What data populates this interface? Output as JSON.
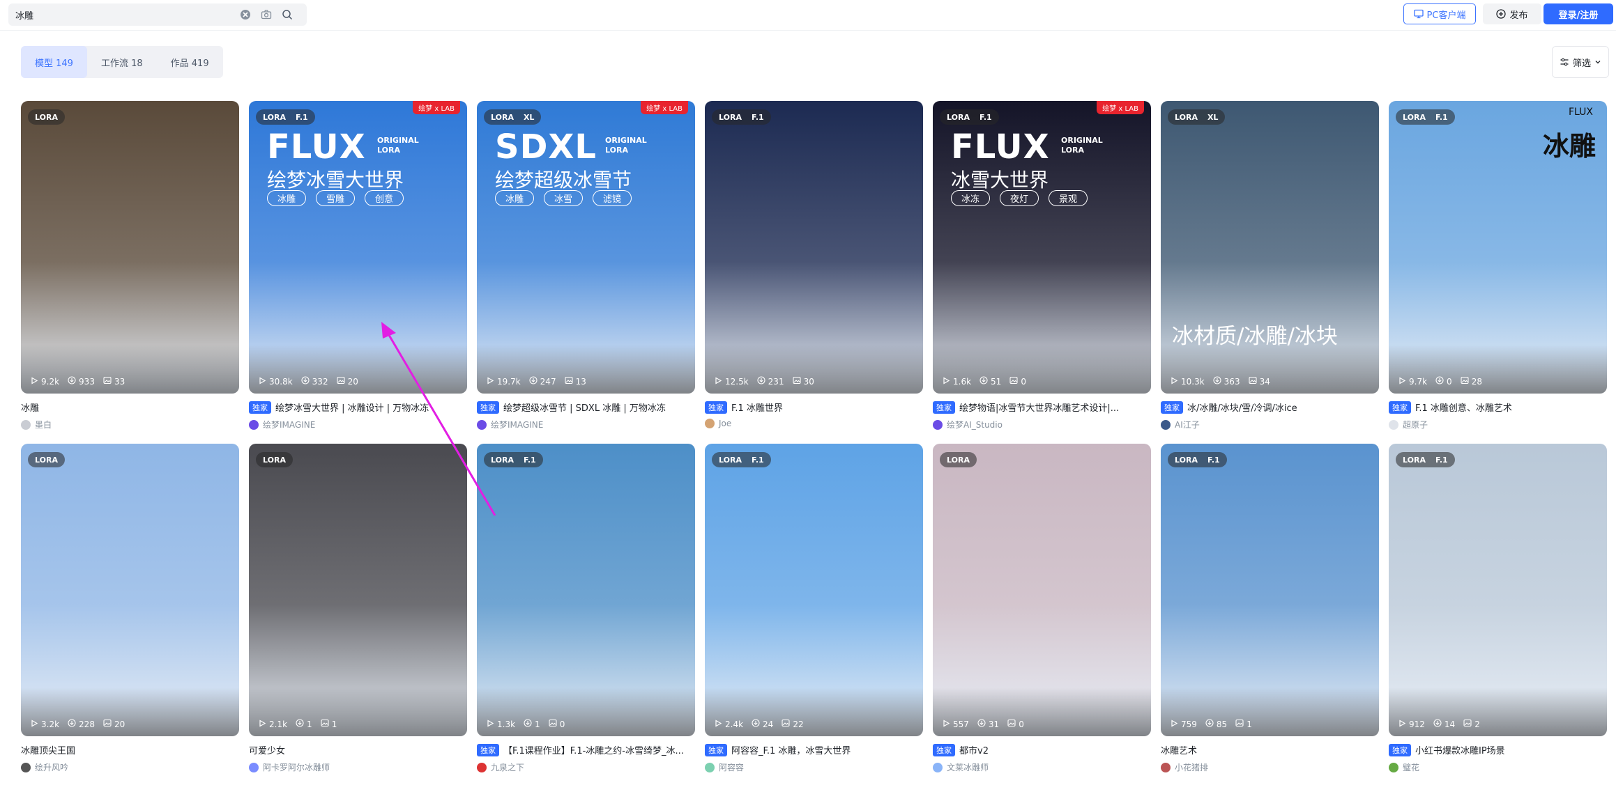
{
  "search": {
    "value": "冰雕"
  },
  "header": {
    "pc_client": "PC客户端",
    "publish": "发布",
    "login": "登录/注册"
  },
  "tabs": [
    {
      "label": "模型 149",
      "active": true
    },
    {
      "label": "工作流 18",
      "active": false
    },
    {
      "label": "作品 419",
      "active": false
    }
  ],
  "filter": {
    "label": "筛选"
  },
  "badge_exclusive": "独家",
  "cards": [
    {
      "tags": [
        "LORA"
      ],
      "runs": "9.2k",
      "downloads": "933",
      "images": "33",
      "title": "冰雕",
      "exclusive": false,
      "author": "墨白",
      "bg": "#5a4a3a"
    },
    {
      "tags": [
        "LORA",
        "F.1"
      ],
      "ribbon": "绘梦 x LAB",
      "poster": {
        "big": "FLUX",
        "small": "ORIGINAL LORA",
        "sub": "绘梦冰雪大世界",
        "chips": [
          "冰雕",
          "雪雕",
          "创意"
        ]
      },
      "runs": "30.8k",
      "downloads": "332",
      "images": "20",
      "title": "绘梦冰雪大世界 | 冰雕设计 | 万物冰冻",
      "exclusive": true,
      "author": "绘梦IMAGINE",
      "bg": "#2e78d8"
    },
    {
      "tags": [
        "LORA",
        "XL"
      ],
      "ribbon": "绘梦 x LAB",
      "poster": {
        "big": "SDXL",
        "small": "ORIGINAL LORA",
        "sub": "绘梦超级冰雪节",
        "chips": [
          "冰雕",
          "冰雪",
          "滤镜"
        ]
      },
      "runs": "19.7k",
      "downloads": "247",
      "images": "13",
      "title": "绘梦超级冰雪节 | SDXL 冰雕 | 万物冰冻",
      "exclusive": true,
      "author": "绘梦IMAGINE",
      "bg": "#2f7ad6"
    },
    {
      "tags": [
        "LORA",
        "F.1"
      ],
      "runs": "12.5k",
      "downloads": "231",
      "images": "30",
      "title": "F.1 冰雕世界",
      "exclusive": true,
      "author": "Joe",
      "bg": "#1c2a52"
    },
    {
      "tags": [
        "LORA",
        "F.1"
      ],
      "ribbon": "绘梦 x LAB",
      "poster": {
        "big": "FLUX",
        "small": "ORIGINAL LORA",
        "sub": "冰雪大世界",
        "chips": [
          "冰冻",
          "夜灯",
          "景观"
        ]
      },
      "runs": "1.6k",
      "downloads": "51",
      "images": "0",
      "title": "绘梦物语|冰雪节大世界冰雕艺术设计|...",
      "exclusive": true,
      "author": "绘梦AI_Studio",
      "bg": "#141428"
    },
    {
      "tags": [
        "LORA",
        "XL"
      ],
      "runs": "10.3k",
      "downloads": "363",
      "images": "34",
      "title": "冰/冰雕/冰块/雪/冷调/冰ice",
      "exclusive": true,
      "author": "AI江子",
      "poster_text": "冰材质/冰雕/冰块",
      "bg": "#3e5872"
    },
    {
      "tags": [
        "LORA",
        "F.1"
      ],
      "runs": "9.7k",
      "downloads": "0",
      "images": "28",
      "title": "F.1 冰雕创意、冰雕艺术",
      "exclusive": true,
      "author": "超原子",
      "corner_big": "冰雕",
      "corner_small": "FLUX",
      "bg": "#6aa6e0"
    },
    {
      "tags": [
        "LORA"
      ],
      "runs": "3.2k",
      "downloads": "228",
      "images": "20",
      "title": "冰雕顶尖王国",
      "exclusive": false,
      "author": "绘升风吟",
      "bg": "#8fb6e6"
    },
    {
      "tags": [
        "LORA"
      ],
      "runs": "2.1k",
      "downloads": "1",
      "images": "1",
      "title": "可爱少女",
      "exclusive": false,
      "author": "阿卡罗阿尔冰雕师",
      "bg": "#4a4a50"
    },
    {
      "tags": [
        "LORA",
        "F.1"
      ],
      "runs": "1.3k",
      "downloads": "1",
      "images": "0",
      "title": "【F.1课程作业】F.1-冰雕之约-冰雪绮梦_冰...",
      "exclusive": true,
      "author": "九泉之下",
      "bg": "#4d8fc8"
    },
    {
      "tags": [
        "LORA",
        "F.1"
      ],
      "runs": "2.4k",
      "downloads": "24",
      "images": "22",
      "title": "阿容容_F.1 冰雕，冰雪大世界",
      "exclusive": true,
      "author": "阿容容",
      "bg": "#5ea3e6"
    },
    {
      "tags": [
        "LORA"
      ],
      "runs": "557",
      "downloads": "31",
      "images": "0",
      "title": "都市v2",
      "exclusive": true,
      "author": "文莱冰雕师",
      "bg": "#c9b7c2"
    },
    {
      "tags": [
        "LORA",
        "F.1"
      ],
      "runs": "759",
      "downloads": "85",
      "images": "1",
      "title": "冰雕艺术",
      "exclusive": false,
      "author": "小花猪排",
      "bg": "#5a93cf"
    },
    {
      "tags": [
        "LORA",
        "F.1"
      ],
      "runs": "912",
      "downloads": "14",
      "images": "2",
      "title": "小红书爆款冰雕IP场景",
      "exclusive": true,
      "author": "璧花",
      "bg": "#b9c8d8"
    }
  ]
}
